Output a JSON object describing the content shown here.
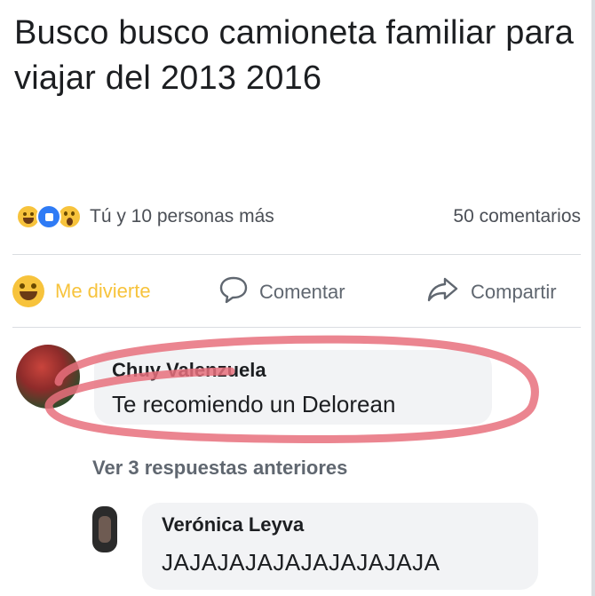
{
  "post": {
    "text": "Busco busco camioneta familiar para viajar del 2013 2016"
  },
  "stats": {
    "reactions": [
      "haha-icon",
      "like-icon",
      "wow-icon"
    ],
    "reactions_text": "Tú y 10 personas más",
    "comments_count": "50 comentarios"
  },
  "actions": {
    "haha_label": "Me divierte",
    "comment_label": "Comentar",
    "share_label": "Compartir"
  },
  "comment": {
    "author": "Chuy Valenzuela",
    "text": "Te recomiendo un Delorean",
    "highlight_color": "#e8707d"
  },
  "replies": {
    "view_previous": "Ver 3 respuestas anteriores",
    "items": [
      {
        "author": "Verónica Leyva",
        "text": "JAJAJAJAJAJAJAJAJAJA"
      }
    ]
  },
  "colors": {
    "text": "#1c1e21",
    "muted": "#606770",
    "bubble": "#f2f3f5",
    "haha": "#f7c33c",
    "like": "#2f7bf5"
  }
}
